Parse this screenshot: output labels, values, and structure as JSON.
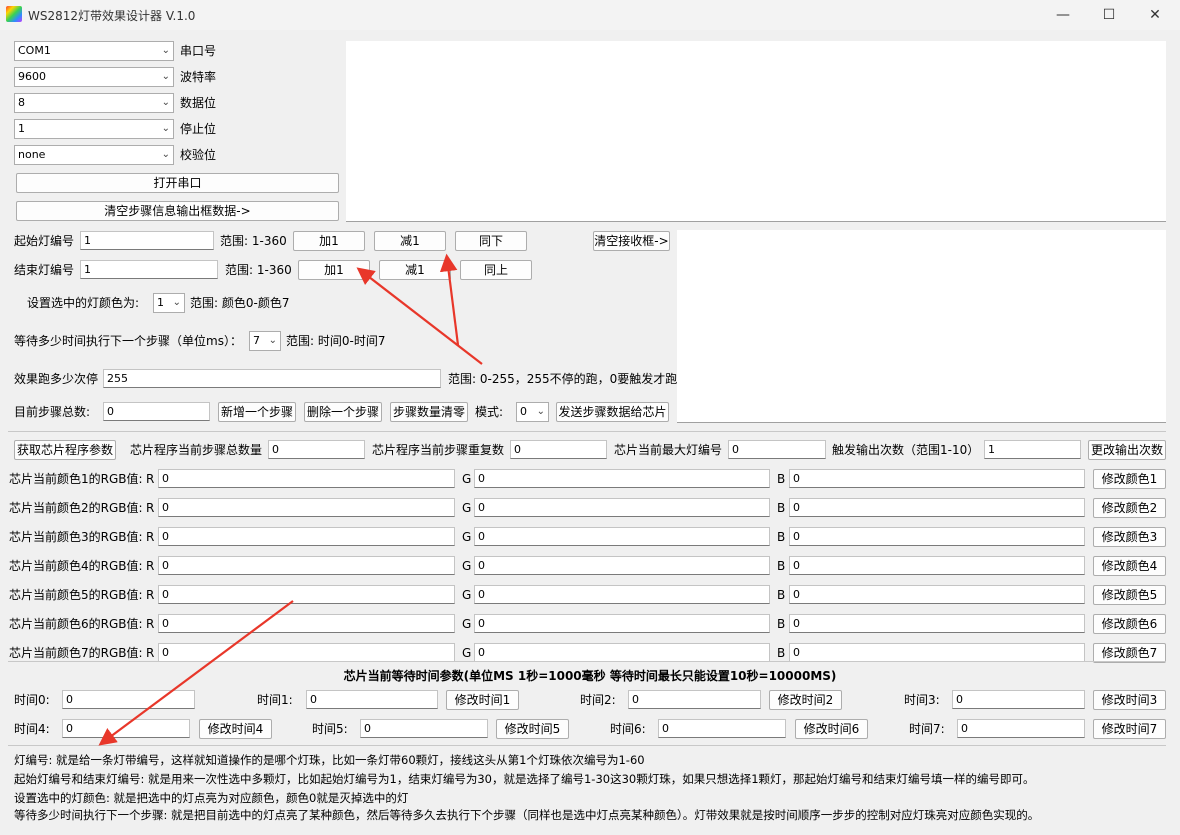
{
  "window": {
    "title": "WS2812灯带效果设计器 V.1.0"
  },
  "serial": {
    "port": {
      "value": "COM1",
      "label": "串口号"
    },
    "baud": {
      "value": "9600",
      "label": "波特率"
    },
    "databits": {
      "value": "8",
      "label": "数据位"
    },
    "stopbits": {
      "value": "1",
      "label": "停止位"
    },
    "parity": {
      "value": "none",
      "label": "校验位"
    },
    "open_btn": "打开串口",
    "clear_step_btn": "清空步骤信息输出框数据->"
  },
  "steps": {
    "start_label": "起始灯编号",
    "start_value": "1",
    "start_range": "范围: 1-360",
    "add1": "加1",
    "sub1": "减1",
    "same_down": "同下",
    "end_label": "结束灯编号",
    "end_value": "1",
    "end_range": "范围: 1-360",
    "add1_b": "加1",
    "sub1_b": "减1",
    "same_up": "同上",
    "clear_recv_btn": "清空接收框->",
    "color_label": "设置选中的灯颜色为:",
    "color_value": "1",
    "color_range": "范围: 颜色0-颜色7",
    "wait_label": "等待多少时间执行下一个步骤（单位ms）：",
    "wait_value": "7",
    "wait_range": "范围: 时间0-时间7",
    "loop_label": "效果跑多少次停",
    "loop_value": "255",
    "loop_range": "范围: 0-255，255不停的跑，0要触发才跑",
    "total_label": "目前步骤总数:",
    "total_value": "0",
    "add_step": "新增一个步骤",
    "del_step": "删除一个步骤",
    "clear_steps": "步骤数量清零",
    "mode_label": "模式:",
    "mode_value": "0",
    "send_btn": "发送步骤数据给芯片"
  },
  "chip": {
    "get_params": "获取芯片程序参数",
    "total_label": "芯片程序当前步骤总数量",
    "total_value": "0",
    "repeat_label": "芯片程序当前步骤重复数",
    "repeat_value": "0",
    "maxled_label": "芯片当前最大灯编号",
    "maxled_value": "0",
    "trigger_label": "触发输出次数（范围1-10）",
    "trigger_value": "1",
    "change_output": "更改输出次数"
  },
  "colors": {
    "r": "R",
    "g": "G",
    "b": "B",
    "rows": [
      {
        "label": "芯片当前颜色1的RGB值:",
        "r": "0",
        "g": "0",
        "b": "0",
        "btn": "修改颜色1"
      },
      {
        "label": "芯片当前颜色2的RGB值:",
        "r": "0",
        "g": "0",
        "b": "0",
        "btn": "修改颜色2"
      },
      {
        "label": "芯片当前颜色3的RGB值:",
        "r": "0",
        "g": "0",
        "b": "0",
        "btn": "修改颜色3"
      },
      {
        "label": "芯片当前颜色4的RGB值:",
        "r": "0",
        "g": "0",
        "b": "0",
        "btn": "修改颜色4"
      },
      {
        "label": "芯片当前颜色5的RGB值:",
        "r": "0",
        "g": "0",
        "b": "0",
        "btn": "修改颜色5"
      },
      {
        "label": "芯片当前颜色6的RGB值:",
        "r": "0",
        "g": "0",
        "b": "0",
        "btn": "修改颜色6"
      },
      {
        "label": "芯片当前颜色7的RGB值:",
        "r": "0",
        "g": "0",
        "b": "0",
        "btn": "修改颜色7"
      }
    ]
  },
  "timing": {
    "title": "芯片当前等待时间参数(单位MS   1秒=1000毫秒   等待时间最长只能设置10秒=10000MS)",
    "items": [
      {
        "label": "时间0:",
        "value": "0"
      },
      {
        "label": "时间1:",
        "value": "0",
        "btn": "修改时间1"
      },
      {
        "label": "时间2:",
        "value": "0",
        "btn": "修改时间2"
      },
      {
        "label": "时间3:",
        "value": "0",
        "btn": "修改时间3"
      },
      {
        "label": "时间4:",
        "value": "0",
        "btn": "修改时间4"
      },
      {
        "label": "时间5:",
        "value": "0",
        "btn": "修改时间5"
      },
      {
        "label": "时间6:",
        "value": "0",
        "btn": "修改时间6"
      },
      {
        "label": "时间7:",
        "value": "0",
        "btn": "修改时间7"
      }
    ]
  },
  "help": {
    "lines": [
      "灯编号: 就是给一条灯带编号，这样就知道操作的是哪个灯珠，比如一条灯带60颗灯，接线这头从第1个灯珠依次编号为1-60",
      "起始灯编号和结束灯编号: 就是用来一次性选中多颗灯，比如起始灯编号为1，结束灯编号为30，就是选择了编号1-30这30颗灯珠，如果只想选择1颗灯，那起始灯编号和结束灯编号填一样的编号即可。",
      "设置选中的灯颜色: 就是把选中的灯点亮为对应颜色，颜色0就是灭掉选中的灯",
      "等待多少时间执行下一个步骤: 就是把目前选中的灯点亮了某种颜色，然后等待多久去执行下个步骤（同样也是选中灯点亮某种颜色）。灯带效果就是按时间顺序一步步的控制对应灯珠亮对应颜色实现的。"
    ]
  },
  "colors_theme": {
    "annotation_arrow": "#e8372a"
  }
}
